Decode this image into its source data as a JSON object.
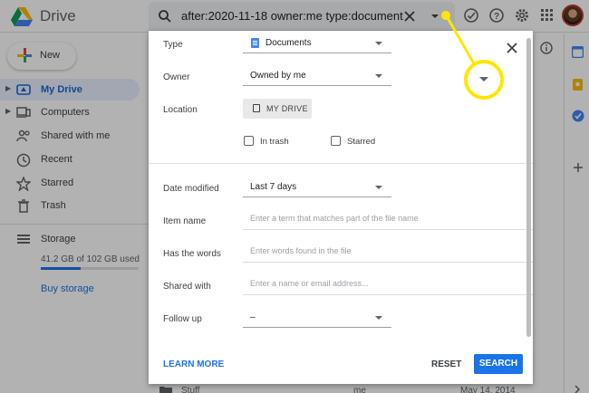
{
  "header": {
    "app_title": "Drive",
    "search_query": "after:2020-11-18 owner:me type:document",
    "icons": [
      "search-icon",
      "clear-icon",
      "search-options-icon",
      "offline-check-icon",
      "help-icon",
      "settings-icon",
      "apps-icon",
      "avatar"
    ]
  },
  "sidebar": {
    "new_label": "New",
    "items": [
      {
        "label": "My Drive",
        "icon": "my-drive-icon",
        "active": true
      },
      {
        "label": "Computers",
        "icon": "computers-icon"
      },
      {
        "label": "Shared with me",
        "icon": "shared-icon"
      },
      {
        "label": "Recent",
        "icon": "clock-icon"
      },
      {
        "label": "Starred",
        "icon": "star-icon"
      },
      {
        "label": "Trash",
        "icon": "trash-icon"
      },
      {
        "label": "Storage",
        "icon": "storage-icon"
      }
    ],
    "storage_text": "41.2 GB of 102 GB used",
    "storage_used_fraction": 0.404,
    "buy_storage": "Buy storage"
  },
  "background": {
    "row_name": "Stuff",
    "row_owner": "me",
    "row_date": "May 14, 2014"
  },
  "search_panel": {
    "type_label": "Type",
    "type_value": "Documents",
    "owner_label": "Owner",
    "owner_value": "Owned by me",
    "location_label": "Location",
    "location_button": "MY DRIVE",
    "in_trash_label": "In trash",
    "starred_label": "Starred",
    "date_modified_label": "Date modified",
    "date_modified_value": "Last 7 days",
    "item_name_label": "Item name",
    "item_name_placeholder": "Enter a term that matches part of the file name",
    "has_words_label": "Has the words",
    "has_words_placeholder": "Enter words found in the file",
    "shared_with_label": "Shared with",
    "shared_with_placeholder": "Enter a name or email address...",
    "follow_up_label": "Follow up",
    "follow_up_value": "–",
    "learn_more": "LEARN MORE",
    "reset": "RESET",
    "search": "SEARCH"
  },
  "colors": {
    "accent": "#1a73e8",
    "callout": "#ffe600",
    "active_nav": "#e8f0fe"
  }
}
